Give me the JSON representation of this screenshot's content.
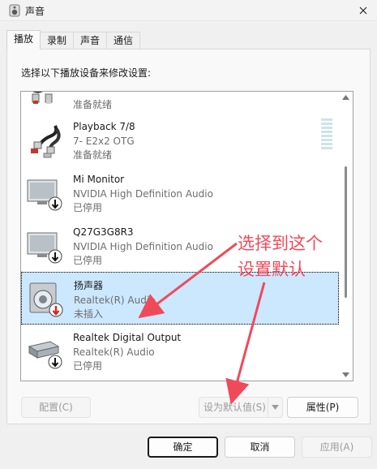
{
  "window": {
    "title": "声音",
    "icon": "speaker-icon",
    "close_icon": "close-icon"
  },
  "tabs": [
    {
      "label": "播放",
      "active": true
    },
    {
      "label": "录制",
      "active": false
    },
    {
      "label": "声音",
      "active": false
    },
    {
      "label": "通信",
      "active": false
    }
  ],
  "instruction": "选择以下播放设备来修改设置:",
  "devices": [
    {
      "name": "",
      "detail": "",
      "status": "准备就绪",
      "icon": "rca-cable-icon"
    },
    {
      "name": "Playback 7/8",
      "detail": "7- E2x2 OTG",
      "status": "准备就绪",
      "icon": "rca-cable-icon"
    },
    {
      "name": "Mi Monitor",
      "detail": "NVIDIA High Definition Audio",
      "status": "已停用",
      "icon": "monitor-icon"
    },
    {
      "name": "Q27G3G8R3",
      "detail": "NVIDIA High Definition Audio",
      "status": "已停用",
      "icon": "monitor-icon"
    },
    {
      "name": "扬声器",
      "detail": "Realtek(R) Audio",
      "status": "未插入",
      "icon": "speaker-box-icon"
    },
    {
      "name": "Realtek Digital Output",
      "detail": "Realtek(R) Audio",
      "status": "已停用",
      "icon": "digital-output-icon"
    }
  ],
  "buttons": {
    "configure": "配置(C)",
    "set_default": "设为默认值(S)",
    "properties": "属性(P)",
    "ok": "确定",
    "cancel": "取消",
    "apply": "应用(A)"
  },
  "annotation": {
    "line1": "选择到这个",
    "line2": "设置默认",
    "color": "#f04a5a"
  }
}
